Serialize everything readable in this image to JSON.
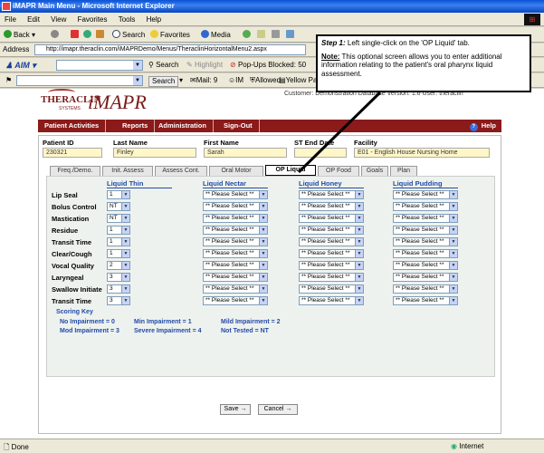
{
  "window": {
    "title": "iMAPR Main Menu - Microsoft Internet Explorer"
  },
  "menu": [
    "File",
    "Edit",
    "View",
    "Favorites",
    "Tools",
    "Help"
  ],
  "toolbar": {
    "back": "Back",
    "search": "Search",
    "favorites": "Favorites",
    "media": "Media"
  },
  "address": {
    "label": "Address",
    "url": "http://imapr.theraclin.com/iMAPRDemo/Menus/TheraclinHorizontalMenu2.aspx"
  },
  "aim": {
    "label": "AIM",
    "search": "Search",
    "highlight": "Highlight",
    "popups": "Pop-Ups Blocked: 50"
  },
  "bar2": {
    "search": "Search",
    "mail": "Mail: 9",
    "im": "IM",
    "allowed": "Allowed",
    "yellow": "Yellow Pag"
  },
  "app": {
    "logo_thera": "THERACLIN",
    "logo_systems": "SYSTEMS",
    "logo_imapr": "iMAPR",
    "customer_line": "Customer: Demonstration Database  Version: 1.6  User: theraclin"
  },
  "nav": {
    "items": [
      "Patient Activities",
      "Reports",
      "Administration",
      "Sign-Out"
    ],
    "help": "Help"
  },
  "patient": {
    "id_label": "Patient ID",
    "id": "230321",
    "last_label": "Last Name",
    "last": "Finley",
    "first_label": "First Name",
    "first": "Sarah",
    "st_end_label": "ST End Date",
    "st_end": "",
    "facility_label": "Facility",
    "facility": "E01 - English House Nursing Home"
  },
  "tabs": [
    "Freq./Demo.",
    "Init. Assess",
    "Assess Cont.",
    "Oral Motor",
    "OP Liquid",
    "OP Food",
    "Goals",
    "Plan"
  ],
  "columns": [
    "Liquid Thin",
    "Liquid Nectar",
    "Liquid Honey",
    "Liquid Pudding"
  ],
  "rows": [
    {
      "label": "Lip Seal",
      "thin": "1"
    },
    {
      "label": "Bolus Control",
      "thin": "NT"
    },
    {
      "label": "Mastication",
      "thin": "NT"
    },
    {
      "label": "Residue",
      "thin": "1"
    },
    {
      "label": "Transit Time",
      "thin": "1"
    },
    {
      "label": "Clear/Cough",
      "thin": "1"
    },
    {
      "label": "Vocal Quality",
      "thin": "2"
    },
    {
      "label": "Laryngeal",
      "thin": "3"
    },
    {
      "label": "Swallow Initiate",
      "thin": "3"
    },
    {
      "label": "Transit Time",
      "thin": "3"
    }
  ],
  "please_select": "** Please Select **",
  "scoring_key": {
    "title": "Scoring Key",
    "items": [
      "No Impairment = 0",
      "Min Impairment = 1",
      "Mild Impairment = 2",
      "Mod Impairment = 3",
      "Severe Impairment = 4",
      "Not Tested = NT"
    ]
  },
  "buttons": {
    "save": "Save",
    "cancel": "Cancel"
  },
  "callout": {
    "step": "Step 1:",
    "step_text": " Left single-click on the 'OP Liquid' tab.",
    "note": "Note:",
    "note_text": " This optional screen allows you to enter additional information relating to the patient's oral pharynx liquid assessment."
  },
  "status": {
    "left": "Done",
    "zone": "Internet"
  }
}
